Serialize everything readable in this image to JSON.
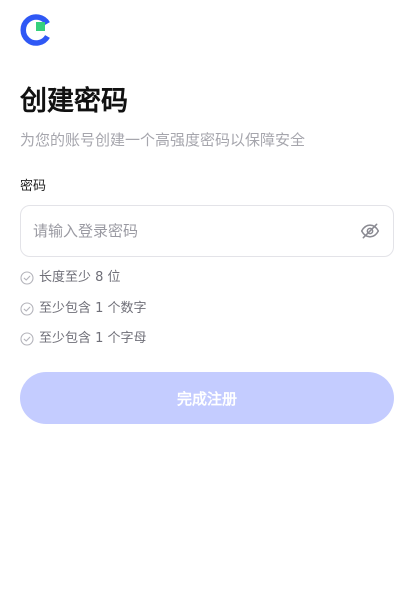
{
  "brand": {
    "logo_icon": "brand-c-logo-icon",
    "primary_color": "#2f58f5",
    "accent_color": "#36d07d"
  },
  "header": {
    "title": "创建密码",
    "subtitle": "为您的账号创建一个高强度密码以保障安全"
  },
  "form": {
    "password_label": "密码",
    "password_placeholder": "请输入登录密码",
    "password_value": "",
    "visibility_icon": "eye-off-icon"
  },
  "requirements": [
    {
      "text": "长度至少 8 位",
      "icon": "check-circle-icon",
      "met": false
    },
    {
      "text": "至少包含 1 个数字",
      "icon": "check-circle-icon",
      "met": false
    },
    {
      "text": "至少包含 1 个字母",
      "icon": "check-circle-icon",
      "met": false
    }
  ],
  "submit": {
    "label": "完成注册",
    "enabled": false,
    "disabled_color": "#c4ccff"
  }
}
